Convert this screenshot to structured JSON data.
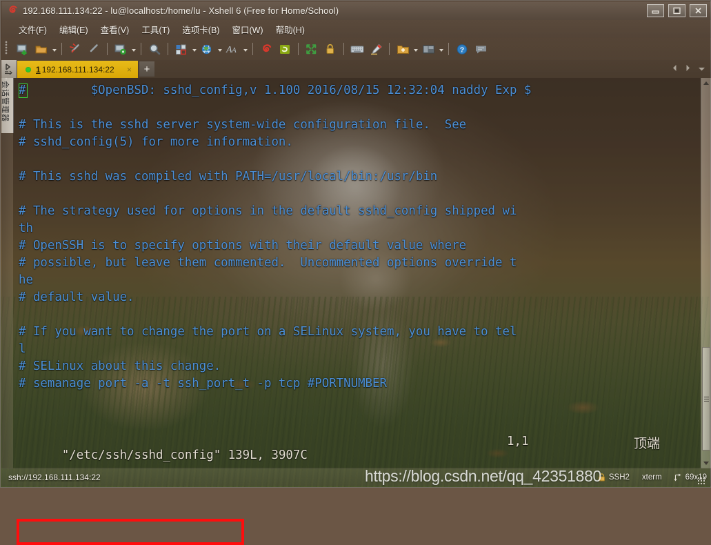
{
  "window": {
    "title": "192.168.111.134:22 - lu@localhost:/home/lu - Xshell 6 (Free for Home/School)",
    "minimize_label": "最小化",
    "maximize_label": "最大化",
    "close_label": "关闭"
  },
  "menubar": {
    "items": [
      {
        "label": "文件(F)",
        "name": "menu-file"
      },
      {
        "label": "编辑(E)",
        "name": "menu-edit"
      },
      {
        "label": "查看(V)",
        "name": "menu-view"
      },
      {
        "label": "工具(T)",
        "name": "menu-tools"
      },
      {
        "label": "选项卡(B)",
        "name": "menu-tabs"
      },
      {
        "label": "窗口(W)",
        "name": "menu-window"
      },
      {
        "label": "帮助(H)",
        "name": "menu-help"
      }
    ]
  },
  "toolbar": {
    "icons": [
      "new-session-icon",
      "open-session-icon",
      "open-session-dropdown",
      "disconnect-icon",
      "reconnect-icon",
      "session-properties-icon",
      "session-properties-dropdown",
      "find-icon",
      "layout-icon",
      "layout-dropdown",
      "globe-icon",
      "globe-dropdown",
      "font-icon",
      "font-dropdown",
      "xshell-icon",
      "xftp-icon",
      "fullscreen-icon",
      "lock-icon",
      "keyboard-icon",
      "highlight-icon",
      "new-folder-icon",
      "new-folder-dropdown",
      "arrange-icon",
      "arrange-dropdown",
      "help-icon",
      "feedback-icon"
    ]
  },
  "sidebar": {
    "session_manager_label": "会话管理器"
  },
  "tabs": {
    "active": {
      "number": "1",
      "title": "192.168.111.134:22",
      "close_label": "×",
      "status": "connected"
    },
    "new_tab_label": "+",
    "nav_prev": "◀",
    "nav_next": "▶",
    "nav_menu": "▾"
  },
  "terminal": {
    "lines": [
      "#         $OpenBSD: sshd_config,v 1.100 2016/08/15 12:32:04 naddy Exp $",
      "",
      "# This is the sshd server system-wide configuration file.  See",
      "# sshd_config(5) for more information.",
      "",
      "# This sshd was compiled with PATH=/usr/local/bin:/usr/bin",
      "",
      "# The strategy used for options in the default sshd_config shipped wi",
      "th",
      "# OpenSSH is to specify options with their default value where",
      "# possible, but leave them commented.  Uncommented options override t",
      "he",
      "# default value.",
      "",
      "# If you want to change the port on a SELinux system, you have to tel",
      "l",
      "# SELinux about this change.",
      "# semanage port -a -t ssh_port_t -p tcp #PORTNUMBER"
    ],
    "cursor_position": "1,1"
  },
  "vim_status": {
    "filename": "\"/etc/ssh/sshd_config\"",
    "file_info": "139L, 3907C",
    "position": "1,1",
    "scroll_state": "顶端"
  },
  "statusbar": {
    "url": "ssh://192.168.111.134:22",
    "protocol": "SSH2",
    "terminal_type": "xterm",
    "size": "69x19",
    "lock_icon": "padlock-icon",
    "size_icon": "resize-icon"
  },
  "watermark": {
    "text": "https://blog.csdn.net/qq_42351880"
  },
  "colors": {
    "terminal_text": "#4b8fd6",
    "tab_active_bg": "#e0ae0c",
    "annotation_red": "#ff0d0d",
    "cursor_green": "#39d03a",
    "status_text": "#e3ddd0"
  }
}
